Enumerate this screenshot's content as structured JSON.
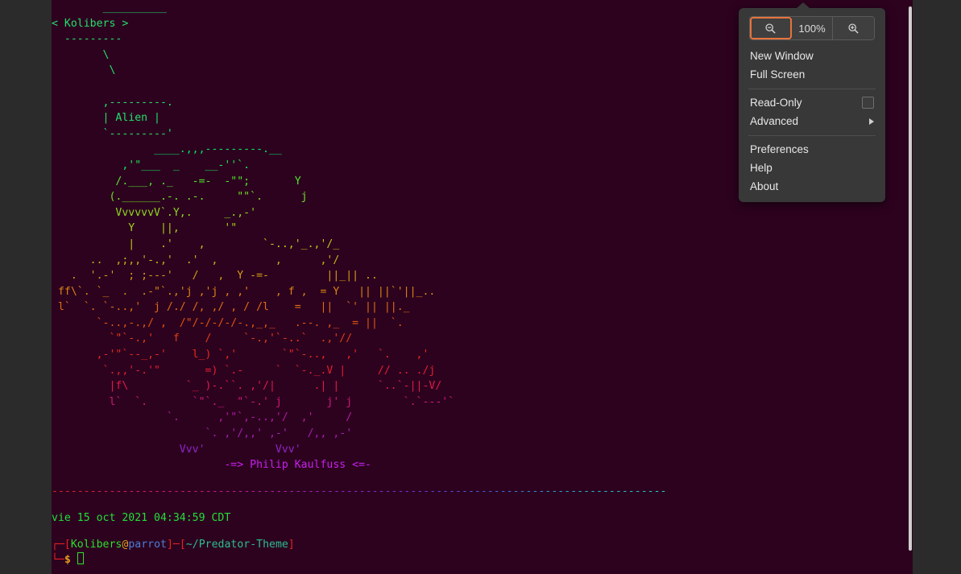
{
  "window": {
    "background_color": "#2b2b2b",
    "terminal_background": "#2d021f"
  },
  "terminal": {
    "header": {
      "top_rule": "        __________",
      "speech_kolibers": "< Kolibers >",
      "dashes_under_kolibers": "  ---------",
      "pointer_line_1": "        \\",
      "pointer_line_2": "         \\",
      "bubble_top": "        ,---------.",
      "bubble_mid": "        | Alien |",
      "bubble_bottom": "        `---------'"
    },
    "ascii_art": [
      "                ____.,,,---------.__",
      "           ,'\"___  _    __-''`.",
      "          /.___, ._   -=-  -\"\";       Y",
      "         (.______.-. .-.     \"\"`.      j",
      "          VvvvvvV`.Y,.     _.,-'",
      "            Y    ||,       '\"",
      "            |    .'    ,         `-..,'_.,'/_",
      "      ..  ,;,,'-.,'  .'  ,         ,      ,'/",
      "   .  '.-'  ; ;---'   /   ,  Y -=-         ||_|| ..",
      " ff\\`. `_  .  .-\"`.,'j ,'j , ,'    , f ,  = Y   || ||`'||_..",
      " l`  `. `-..,'  j /./ /, ,/ , / /l    =   ||  `' || ||._",
      "       `-..,-.,/ ,  /\"/-/-/-/-.,_,_   .--. ,_  = ||  `.",
      "         `\"`-.,'   f    /     `-.,'`-..`  .,'//",
      "       ,-'\"`--_,-'    l_) `,'       `\"`-..,   ,'   `.    ,'",
      "        `.,,'-.'\"       =) `.-     `  `-._.V |     // .. ./j",
      "         |f\\         `_ )-.``. ,'/|      .| |      `..`-||-V/",
      "         l`  `.       `\"`._  \"`-.' j       j' j        `.`---'`",
      "                  `.      ,'\"`,-..,'/  ,'     /",
      "                        `. ,'/,,' ,-'   /,, ,-'",
      "                    Vvv'           Vvv'"
    ],
    "signature": "-=> Philip Kaulfuss <=-",
    "date_line": "vie 15 oct 2021 04:34:59 CDT",
    "prompt": {
      "branch_top": "┌─",
      "branch_bottom": "└─",
      "bracket_open": "[",
      "user": "Kolibers",
      "at": "@",
      "host": "parrot",
      "bracket_close": "]",
      "dash": "─",
      "path_bracket_open": "[",
      "path": "~/Predator-Theme",
      "path_bracket_close": "]",
      "dollar": "$",
      "command": ""
    },
    "separator_char": "-",
    "separator_count": 96
  },
  "menu": {
    "zoom": {
      "zoom_out_icon": "zoom-out-icon",
      "percent": "100%",
      "zoom_in_icon": "zoom-in-icon",
      "focus_color": "#e8733c"
    },
    "items": [
      {
        "label": "New Window",
        "kind": "plain"
      },
      {
        "label": "Full Screen",
        "kind": "plain"
      },
      {
        "label": "Read-Only",
        "kind": "checkbox",
        "checked": false
      },
      {
        "label": "Advanced",
        "kind": "submenu"
      },
      {
        "label": "Preferences",
        "kind": "plain"
      },
      {
        "label": "Help",
        "kind": "plain"
      },
      {
        "label": "About",
        "kind": "plain"
      }
    ]
  },
  "scrollbar": {
    "thumb_color": "#cfcfcf"
  }
}
